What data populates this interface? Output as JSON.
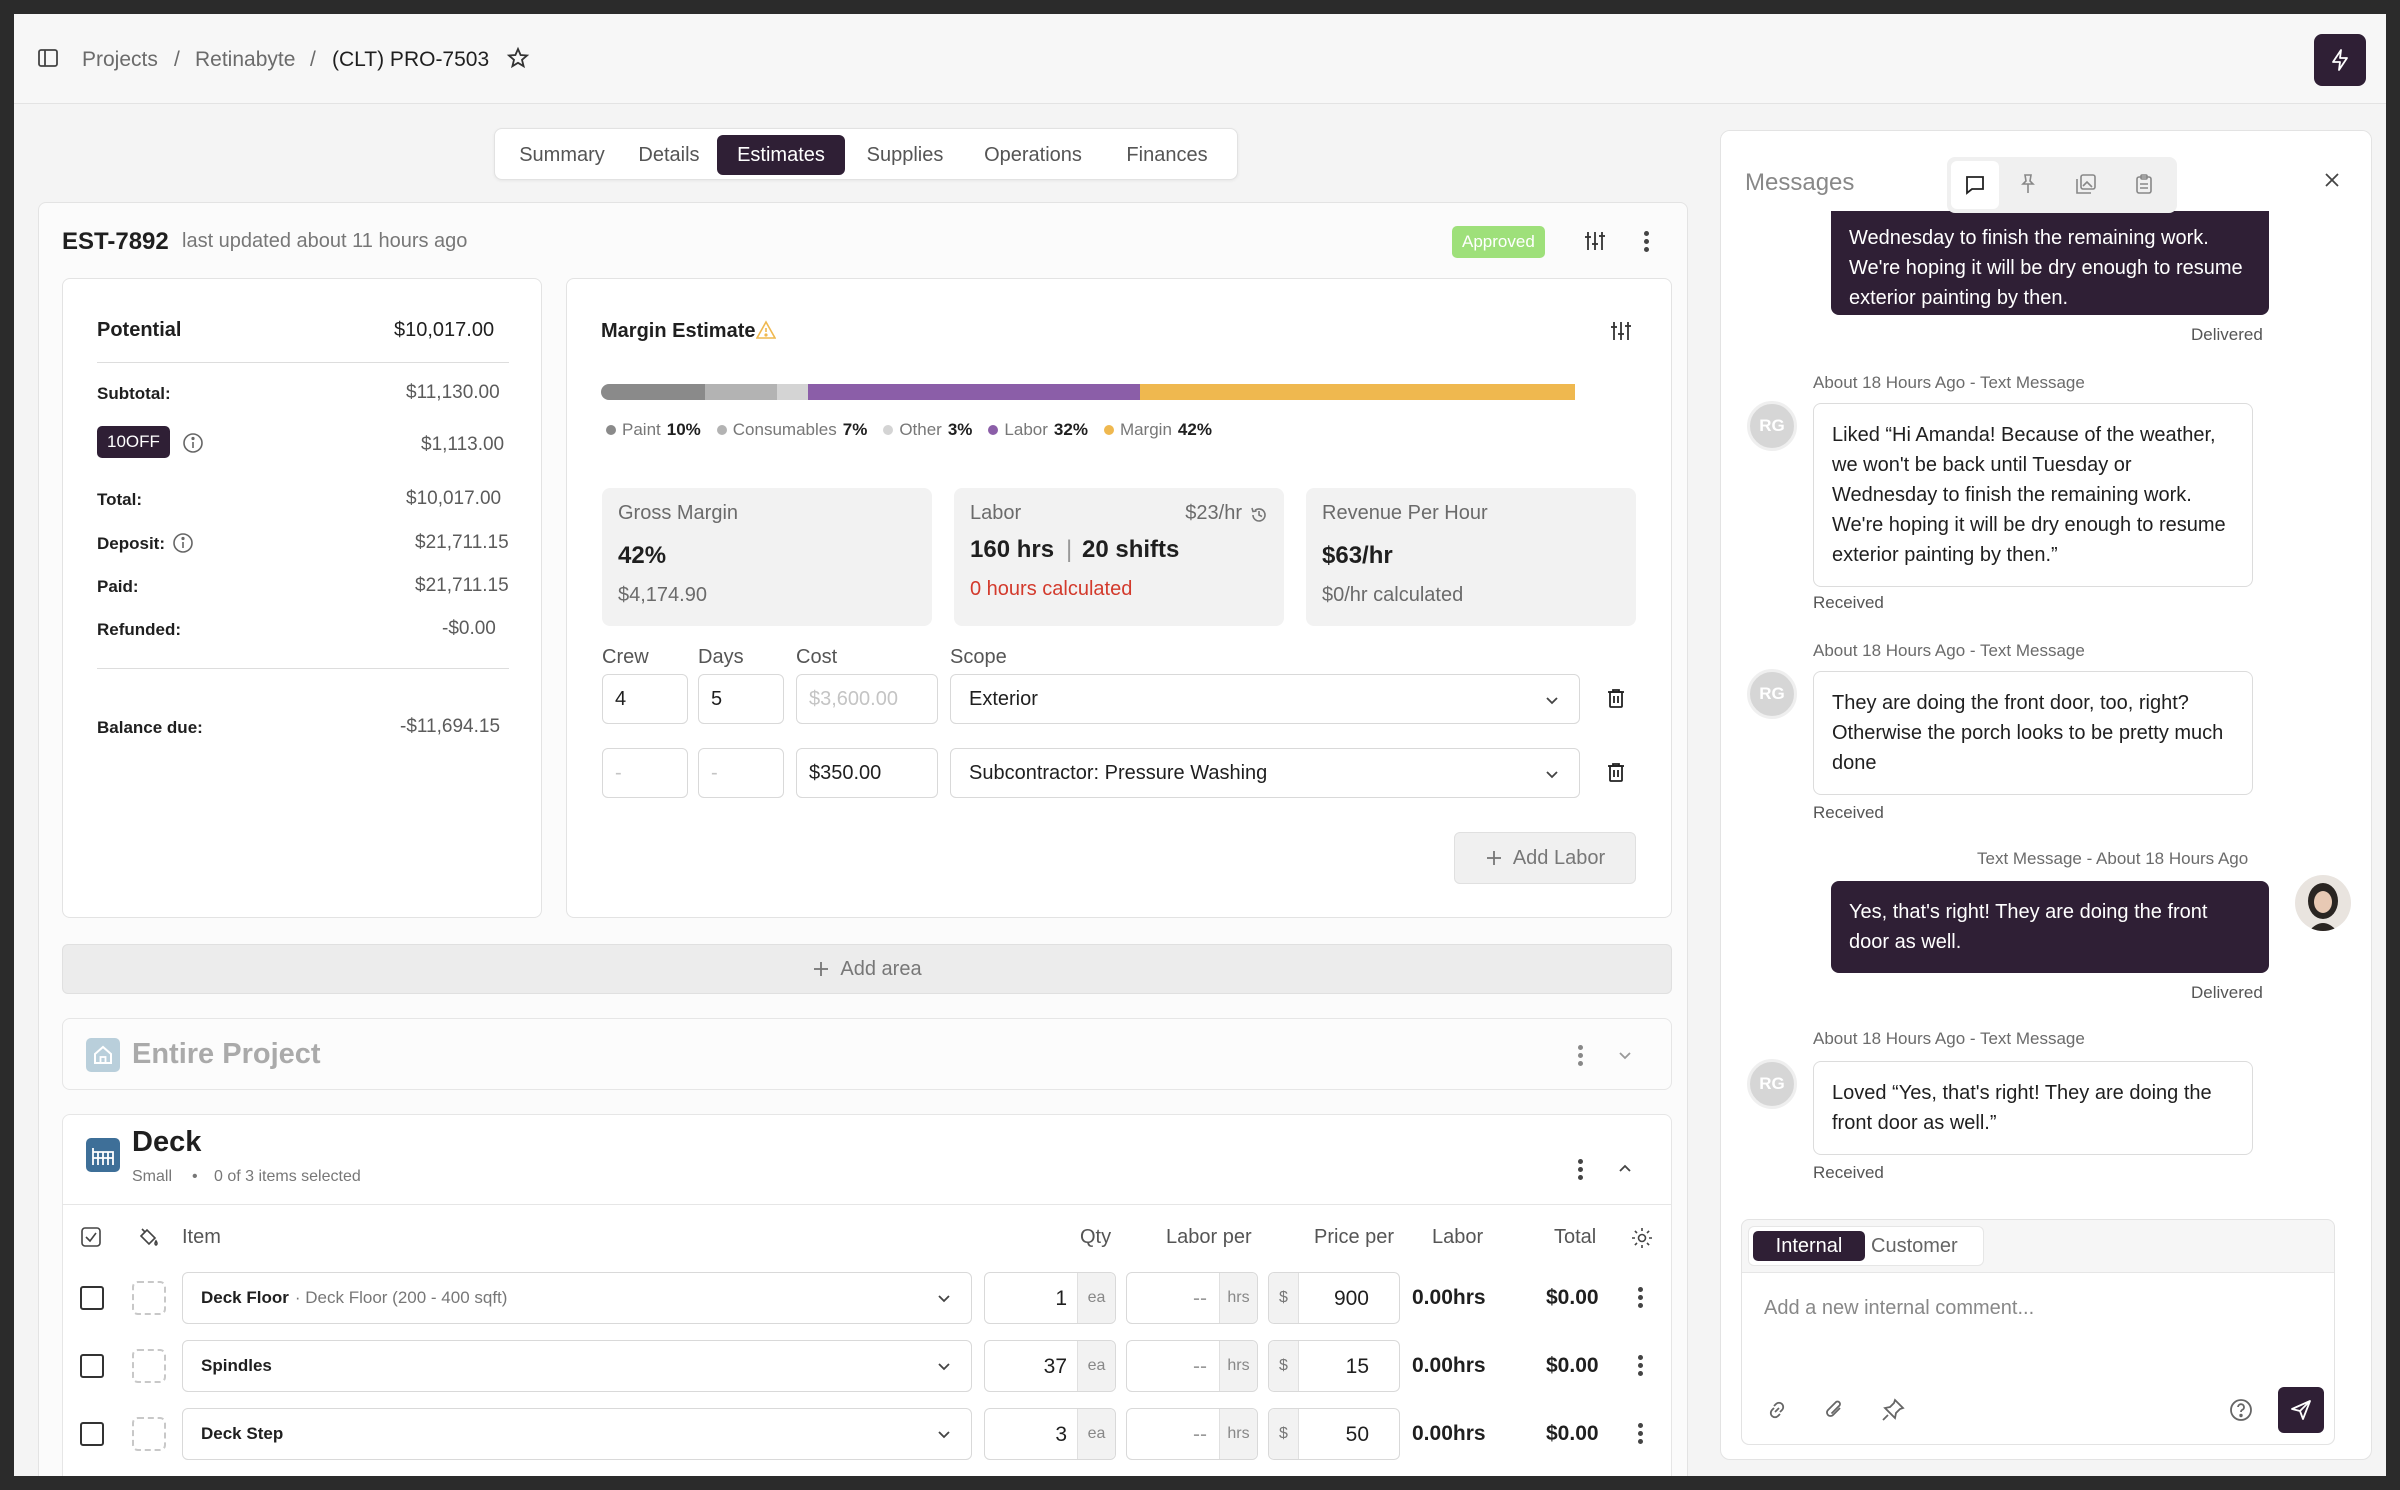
{
  "breadcrumb": {
    "items": [
      "Projects",
      "Retinabyte",
      "(CLT) PRO-7503"
    ],
    "sep": "/"
  },
  "tabs": [
    "Summary",
    "Details",
    "Estimates",
    "Supplies",
    "Operations",
    "Finances"
  ],
  "active_tab": "Estimates",
  "estimate": {
    "id": "EST-7892",
    "updated": "last updated about 11 hours ago",
    "status": "Approved"
  },
  "summary": {
    "potential_label": "Potential",
    "potential_value": "$10,017.00",
    "subtotal_label": "Subtotal:",
    "subtotal_value": "$11,130.00",
    "discount_code": "10OFF",
    "discount_value": "$1,113.00",
    "total_label": "Total:",
    "total_value": "$10,017.00",
    "deposit_label": "Deposit:",
    "deposit_value": "$21,711.15",
    "paid_label": "Paid:",
    "paid_value": "$21,711.15",
    "refunded_label": "Refunded:",
    "refunded_value": "-$0.00",
    "balance_label": "Balance due:",
    "balance_value": "-$11,694.15"
  },
  "margin": {
    "title": "Margin Estimate",
    "bar": [
      {
        "name": "Paint",
        "pct": 10,
        "color": "#8a8a8a"
      },
      {
        "name": "Consumables",
        "pct": 7,
        "color": "#b3b3b3"
      },
      {
        "name": "Other",
        "pct": 3,
        "color": "#d4d4d4"
      },
      {
        "name": "Labor",
        "pct": 32,
        "color": "#8b5ea8"
      },
      {
        "name": "Margin",
        "pct": 42,
        "color": "#efb84f"
      }
    ],
    "legend": [
      {
        "name": "Paint",
        "value": "10%"
      },
      {
        "name": "Consumables",
        "value": "7%"
      },
      {
        "name": "Other",
        "value": "3%"
      },
      {
        "name": "Labor",
        "value": "32%"
      },
      {
        "name": "Margin",
        "value": "42%"
      }
    ],
    "gross_margin": {
      "title": "Gross Margin",
      "pct": "42%",
      "amount": "$4,174.90"
    },
    "labor": {
      "title": "Labor",
      "rate": "$23/hr",
      "hrs": "160 hrs",
      "shifts": "20 shifts",
      "calc": "0 hours calculated"
    },
    "revenue": {
      "title": "Revenue Per Hour",
      "value": "$63/hr",
      "calc": "$0/hr calculated"
    }
  },
  "labor_rows": {
    "headers": {
      "crew": "Crew",
      "days": "Days",
      "cost": "Cost",
      "scope": "Scope"
    },
    "rows": [
      {
        "crew": "4",
        "days": "5",
        "cost": "$3,600.00",
        "scope": "Exterior"
      },
      {
        "crew": "-",
        "days": "-",
        "cost": "$350.00",
        "scope": "Subcontractor: Pressure Washing"
      }
    ],
    "add_labor": "Add Labor"
  },
  "add_area": "Add area",
  "entire_project": "Entire Project",
  "deck": {
    "title": "Deck",
    "size": "Small",
    "bullet": "•",
    "selected": "0 of 3 items selected",
    "columns": {
      "item": "Item",
      "qty": "Qty",
      "labor_per": "Labor per",
      "price_per": "Price per",
      "labor": "Labor",
      "total": "Total"
    },
    "rows": [
      {
        "name": "Deck Floor",
        "detail": "· Deck Floor (200 - 400 sqft)",
        "qty": "1",
        "qty_unit": "ea",
        "labor_per": "--",
        "labor_unit": "hrs",
        "currency": "$",
        "price": "900",
        "labor": "0.00hrs",
        "total": "$0.00"
      },
      {
        "name": "Spindles",
        "detail": "",
        "qty": "37",
        "qty_unit": "ea",
        "labor_per": "--",
        "labor_unit": "hrs",
        "currency": "$",
        "price": "15",
        "labor": "0.00hrs",
        "total": "$0.00"
      },
      {
        "name": "Deck Step",
        "detail": "",
        "qty": "3",
        "qty_unit": "ea",
        "labor_per": "--",
        "labor_unit": "hrs",
        "currency": "$",
        "price": "50",
        "labor": "0.00hrs",
        "total": "$0.00"
      }
    ]
  },
  "messages": {
    "title": "Messages",
    "items": [
      {
        "text": "Wednesday to finish the remaining work. We're hoping it will be dry enough to resume exterior painting by then.",
        "status": "Delivered"
      },
      {
        "meta": "About 18 Hours Ago - Text Message",
        "avatar": "RG",
        "text": "Liked “Hi Amanda! Because of the weather, we won't be back until Tuesday or Wednesday to finish the remaining work. We're hoping it will be dry enough to resume exterior painting by then.”",
        "status": "Received"
      },
      {
        "meta": "About 18 Hours Ago - Text Message",
        "avatar": "RG",
        "text": "They are doing the front door, too, right? Otherwise the porch looks to be pretty much done",
        "status": "Received"
      },
      {
        "meta": "Text Message - About 18 Hours Ago",
        "text": "Yes, that's right! They are doing the front door as well.",
        "status": "Delivered"
      },
      {
        "meta": "About 18 Hours Ago - Text Message",
        "avatar": "RG",
        "text": "Loved “Yes, that's right! They are doing the front door as well.”",
        "status": "Received"
      }
    ],
    "composer": {
      "tab_internal": "Internal",
      "tab_customer": "Customer",
      "placeholder": "Add a new internal comment..."
    }
  }
}
